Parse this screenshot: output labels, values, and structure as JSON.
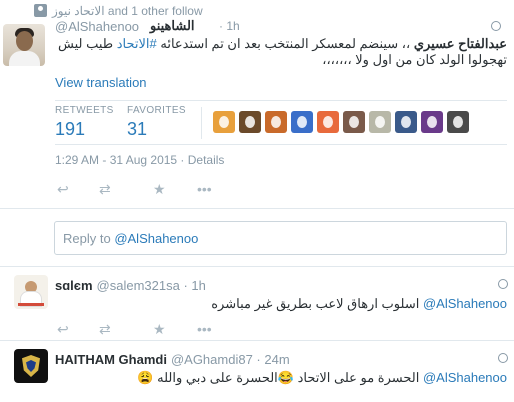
{
  "context": {
    "follow_text": "الاتحاد نيوز and 1 other follow"
  },
  "main_tweet": {
    "display_name": "الشاهينو",
    "handle": "@AlShahenoo",
    "time": "1h",
    "text_bold": "عبدالفتاح عسيري",
    "text_part1": " ،، سينضم لمعسكر المنتخب بعد ان تم استدعائه ",
    "hashtag": "#الاتحاد",
    "text_part2": " طيب ليش تهجولوا الولد كان من اول ولا ،،،،،،،",
    "view_translation": "View translation",
    "retweets_label": "RETWEETS",
    "retweets_count": "191",
    "favorites_label": "FAVORITES",
    "favorites_count": "31",
    "timestamp": "1:29 AM - 31 Aug 2015 · Details",
    "favoriter_colors": [
      "#e8a03c",
      "#6b4a2a",
      "#c96a2a",
      "#3a6ec9",
      "#e86a3c",
      "#7a5a4a",
      "#b8b8a8",
      "#3a5a8a",
      "#6a3a8a",
      "#4a4a4a"
    ],
    "actions": {
      "reply_icon": "reply-icon",
      "retweet_icon": "retweet-icon",
      "favorite_icon": "star-icon",
      "more_icon": "more-icon"
    }
  },
  "reply_box": {
    "prefix": "Reply to ",
    "mention": "@AlShahenoo"
  },
  "replies": [
    {
      "display_name": "sɑlєm",
      "handle": "@salem321sa",
      "time": "1h",
      "mention": "@AlShahenoo",
      "text": "اسلوب ارهاق لاعب بطريق غير مباشره"
    },
    {
      "display_name": "HAITHAM Ghamdi",
      "handle": "@AGhamdi87",
      "time": "24m",
      "mention": "@AlShahenoo",
      "text": "الحسرة مو على الاتحاد 😂الحسرة على دبي والله 😩"
    }
  ]
}
